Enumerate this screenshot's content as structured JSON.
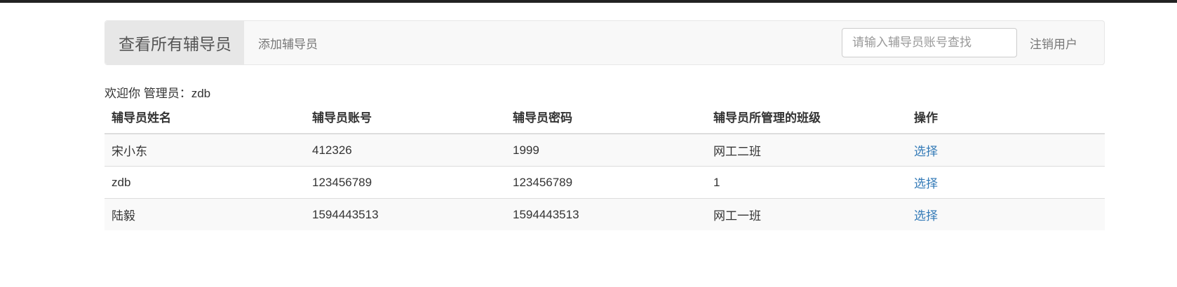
{
  "navbar": {
    "brand": "查看所有辅导员",
    "add_link": "添加辅导员",
    "search_placeholder": "请输入辅导员账号查找",
    "logout": "注销用户"
  },
  "welcome": "欢迎你 管理员：zdb",
  "table": {
    "headers": [
      "辅导员姓名",
      "辅导员账号",
      "辅导员密码",
      "辅导员所管理的班级",
      "操作"
    ],
    "rows": [
      {
        "name": "宋小东",
        "account": "412326",
        "password": "1999",
        "class": "网工二班",
        "action": "选择"
      },
      {
        "name": "zdb",
        "account": "123456789",
        "password": "123456789",
        "class": "1",
        "action": "选择"
      },
      {
        "name": "陆毅",
        "account": "1594443513",
        "password": "1594443513",
        "class": "网工一班",
        "action": "选择"
      }
    ]
  },
  "colors": {
    "link": "#337ab7",
    "navbar_bg": "#f8f8f8",
    "brand_bg": "#e7e7e7"
  }
}
